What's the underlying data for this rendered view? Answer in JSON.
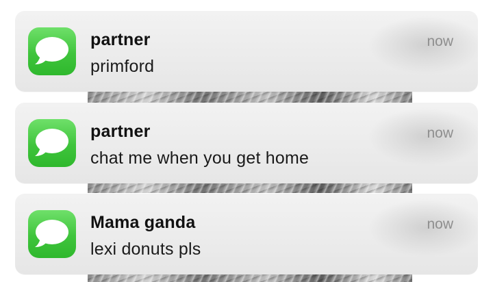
{
  "notifications": [
    {
      "app_icon": "messages-icon",
      "sender": "partner",
      "message": "primford",
      "time": "now"
    },
    {
      "app_icon": "messages-icon",
      "sender": "partner",
      "message": "chat me when you get home",
      "time": "now"
    },
    {
      "app_icon": "messages-icon",
      "sender": "Mama ganda",
      "message": "lexi donuts pls",
      "time": "now"
    }
  ],
  "colors": {
    "messages_icon_green": "#3fc43c",
    "banner_background": "#ebebeb",
    "timestamp_gray": "#8e8e8e"
  }
}
